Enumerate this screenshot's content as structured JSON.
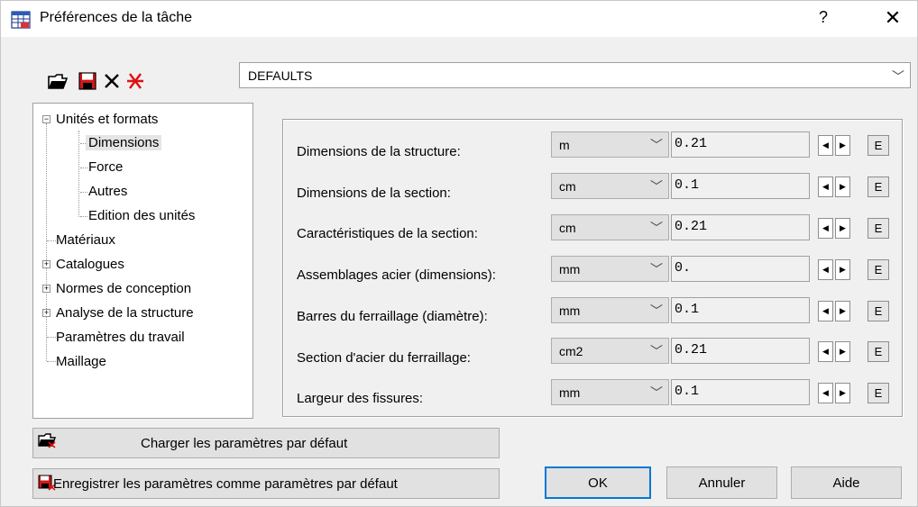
{
  "window": {
    "title": "Préférences de la tâche",
    "help_label": "?",
    "close_label": "✕"
  },
  "toolbar": {
    "icons": [
      "open-folder-icon",
      "save-icon",
      "delete-icon",
      "new-star-icon"
    ]
  },
  "preset": {
    "selected": "DEFAULTS"
  },
  "tree": {
    "items": [
      {
        "label": "Unités et formats",
        "expander": "−"
      },
      {
        "label": "Dimensions"
      },
      {
        "label": "Force"
      },
      {
        "label": "Autres"
      },
      {
        "label": "Edition des unités"
      },
      {
        "label": "Matériaux"
      },
      {
        "label": "Catalogues",
        "expander": "+"
      },
      {
        "label": "Normes de conception",
        "expander": "+"
      },
      {
        "label": "Analyse de la structure",
        "expander": "+"
      },
      {
        "label": "Paramètres du travail"
      },
      {
        "label": "Maillage"
      }
    ]
  },
  "rows": [
    {
      "label": "Dimensions de la structure:",
      "unit": "m",
      "value": "0.21",
      "e": "E"
    },
    {
      "label": "Dimensions de la section:",
      "unit": "cm",
      "value": "0.1",
      "e": "E"
    },
    {
      "label": "Caractéristiques de la section:",
      "unit": "cm",
      "value": "0.21",
      "e": "E"
    },
    {
      "label": "Assemblages acier (dimensions):",
      "unit": "mm",
      "value": "0.",
      "e": "E"
    },
    {
      "label": "Barres du ferraillage (diamètre):",
      "unit": "mm",
      "value": "0.1",
      "e": "E"
    },
    {
      "label": "Section d'acier du ferraillage:",
      "unit": "cm2",
      "value": "0.21",
      "e": "E"
    },
    {
      "label": "Largeur des fissures:",
      "unit": "mm",
      "value": "0.1",
      "e": "E"
    }
  ],
  "buttons": {
    "load_defaults": "Charger les paramètres par défaut",
    "save_defaults": "Enregistrer les paramètres comme paramètres par défaut",
    "ok": "OK",
    "cancel": "Annuler",
    "help": "Aide"
  }
}
